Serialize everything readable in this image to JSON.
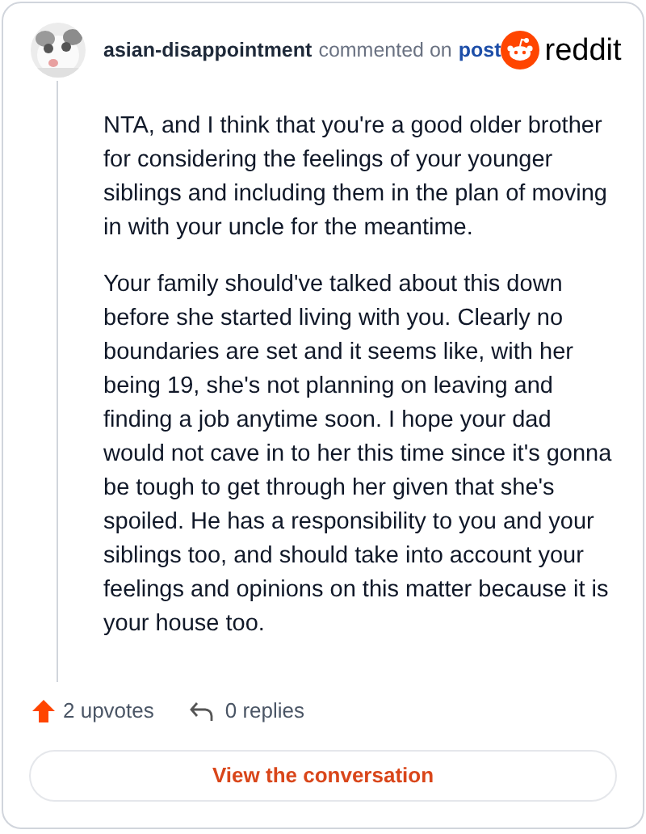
{
  "comment": {
    "author": "asian-disappointment",
    "action": "commented on",
    "link": "post",
    "brand": "reddit",
    "paragraphs": [
      "NTA, and I think that you're a good older brother for considering the feelings of your younger siblings and including them in the plan of moving in with your uncle for the meantime.",
      "Your family should've talked about this down before she started living with you. Clearly no boundaries are set and it seems like, with her being 19, she's not planning on leaving and finding a job anytime soon. I hope your dad would not cave in to her this time since it's gonna be tough to get through her given that she's spoiled. He has a responsibility to you and your siblings too, and should take into account your feelings and opinions on this matter because it is your house too."
    ],
    "upvotes": "2 upvotes",
    "replies": "0 replies"
  },
  "button": {
    "label": "View the conversation"
  }
}
